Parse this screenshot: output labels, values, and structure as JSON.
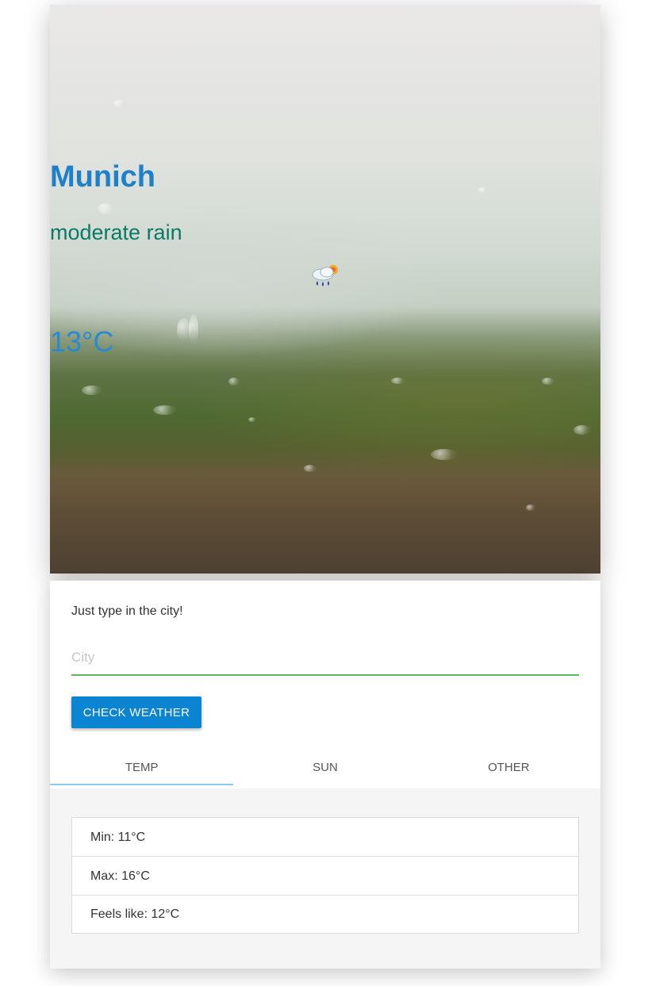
{
  "hero": {
    "city": "Munich",
    "description": "moderate rain",
    "icon": "rain-cloud-sun-icon",
    "temperature": "13°C"
  },
  "form": {
    "hint": "Just type in the city!",
    "city_placeholder": "City",
    "city_value": "",
    "check_button_label": "CHECK WEATHER"
  },
  "tabs": [
    {
      "label": "TEMP",
      "active": true
    },
    {
      "label": "SUN",
      "active": false
    },
    {
      "label": "OTHER",
      "active": false
    }
  ],
  "temp_details": [
    {
      "text": "Min: 11°C"
    },
    {
      "text": "Max: 16°C"
    },
    {
      "text": "Feels like: 12°C"
    }
  ],
  "colors": {
    "city_text": "#1e80c8",
    "description_text": "#0b7a64",
    "temperature_text": "#2a8ad0",
    "button_bg": "#0b84d2",
    "input_underline": "#5cb85c",
    "tab_indicator": "#8ec9e8"
  }
}
